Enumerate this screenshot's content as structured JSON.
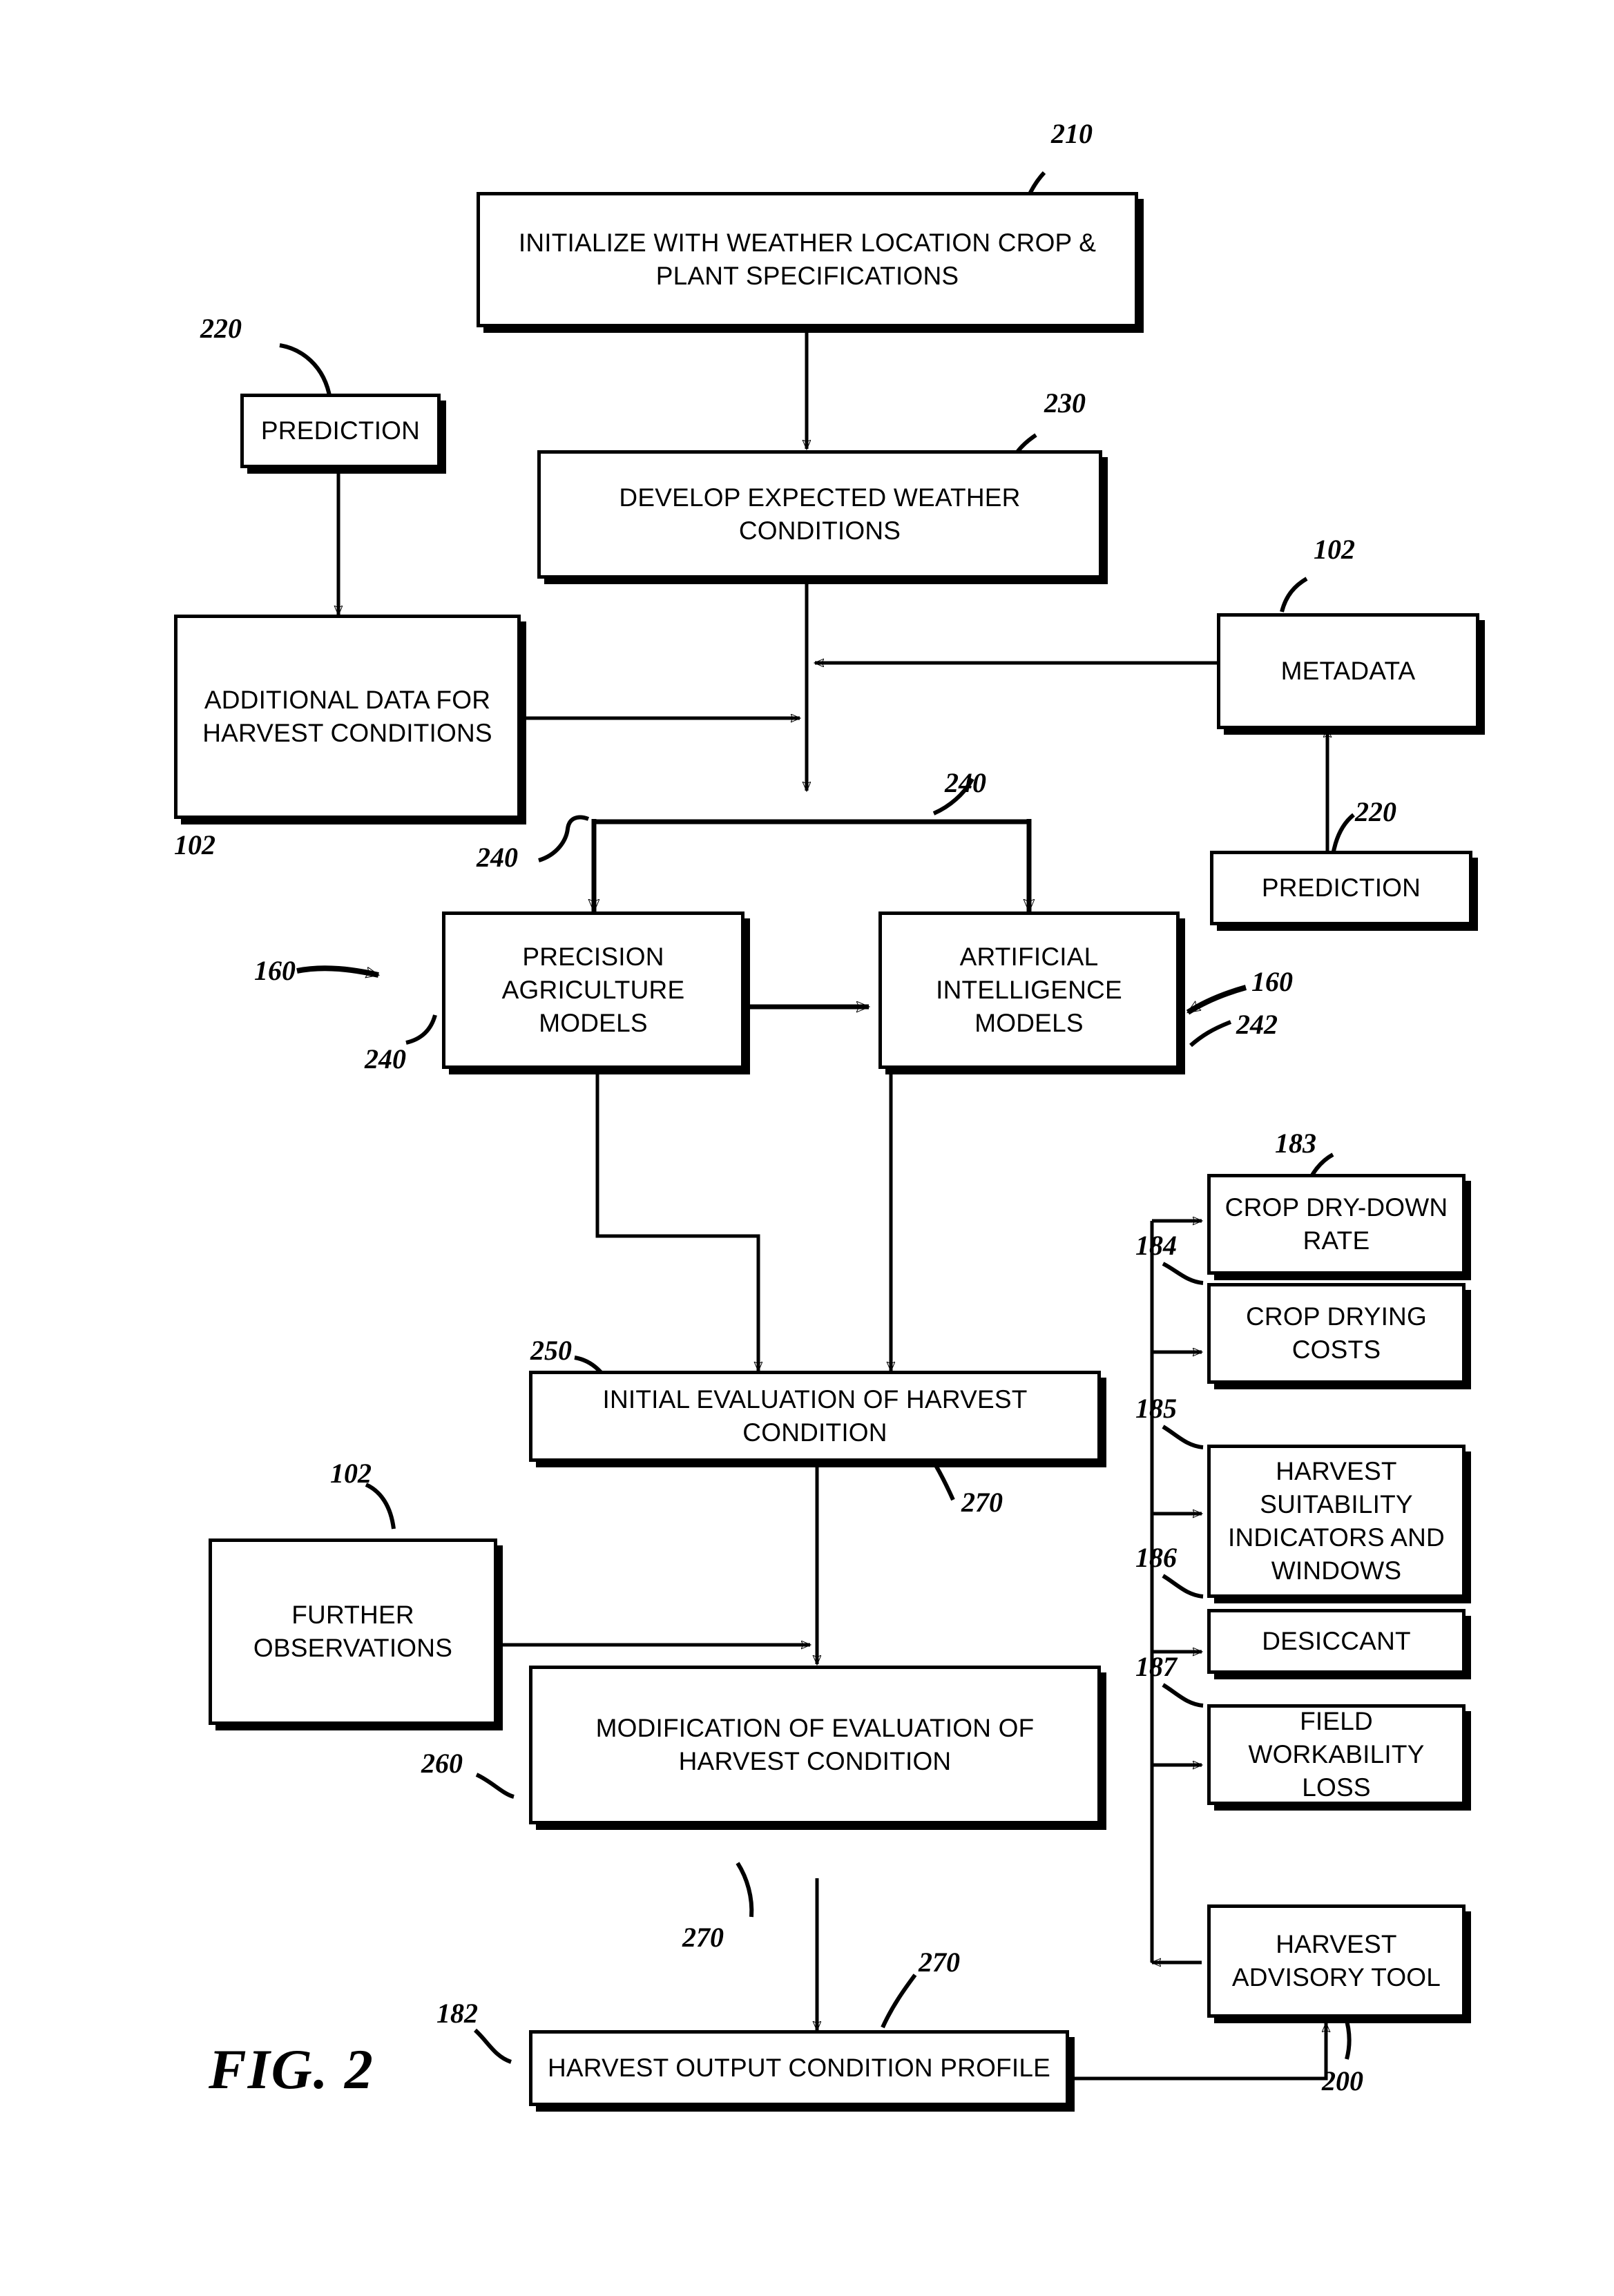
{
  "figure": {
    "label": "FIG. 2",
    "title": "Harvest advisory tool process flow"
  },
  "nodes": {
    "initialize": {
      "label": "INITIALIZE WITH WEATHER LOCATION CROP & PLANT SPECIFICATIONS",
      "ref": "210"
    },
    "prediction_left": {
      "label": "PREDICTION",
      "ref": "220"
    },
    "develop_weather": {
      "label": "DEVELOP EXPECTED WEATHER CONDITIONS",
      "ref": "230"
    },
    "additional_data": {
      "label": "ADDITIONAL DATA FOR HARVEST CONDITIONS",
      "ref": "102"
    },
    "metadata": {
      "label": "METADATA",
      "ref": "102"
    },
    "prediction_right": {
      "label": "PREDICTION",
      "ref": "220"
    },
    "precision_models": {
      "label": "PRECISION AGRICULTURE MODELS",
      "ref": "240",
      "ref2": "160"
    },
    "ai_models": {
      "label": "ARTIFICIAL INTELLIGENCE MODELS",
      "ref": "242",
      "ref2": "160"
    },
    "initial_eval": {
      "label": "INITIAL EVALUATION OF HARVEST CONDITION",
      "ref": "250",
      "ref2": "270"
    },
    "further_obs": {
      "label": "FURTHER OBSERVATIONS",
      "ref": "102"
    },
    "modification": {
      "label": "MODIFICATION OF EVALUATION OF HARVEST CONDITION",
      "ref": "260",
      "ref2": "270"
    },
    "output_profile": {
      "label": "HARVEST OUTPUT CONDITION PROFILE",
      "ref": "182",
      "ref2": "270"
    },
    "dry_down": {
      "label": "CROP DRY-DOWN RATE",
      "ref": "183"
    },
    "drying_costs": {
      "label": "CROP DRYING COSTS",
      "ref": "184"
    },
    "suitability": {
      "label": "HARVEST SUITABILITY INDICATORS AND WINDOWS",
      "ref": "185"
    },
    "desiccant": {
      "label": "DESICCANT",
      "ref": "186"
    },
    "workability": {
      "label": "FIELD WORKABILITY LOSS",
      "ref": "187"
    },
    "advisory_tool": {
      "label": "HARVEST ADVISORY TOOL",
      "ref": "200"
    }
  },
  "reference_numerals": {
    "n210": "210",
    "n220a": "220",
    "n220b": "220",
    "n230": "230",
    "n102a": "102",
    "n102b": "102",
    "n102c": "102",
    "n240a": "240",
    "n240b": "240",
    "n240c": "240",
    "n242": "242",
    "n160a": "160",
    "n160b": "160",
    "n250": "250",
    "n260": "260",
    "n270a": "270",
    "n270b": "270",
    "n270c": "270",
    "n182": "182",
    "n183": "183",
    "n184": "184",
    "n185": "185",
    "n186": "186",
    "n187": "187",
    "n200": "200"
  },
  "style": {
    "line_color": "#000000",
    "background": "#ffffff"
  }
}
